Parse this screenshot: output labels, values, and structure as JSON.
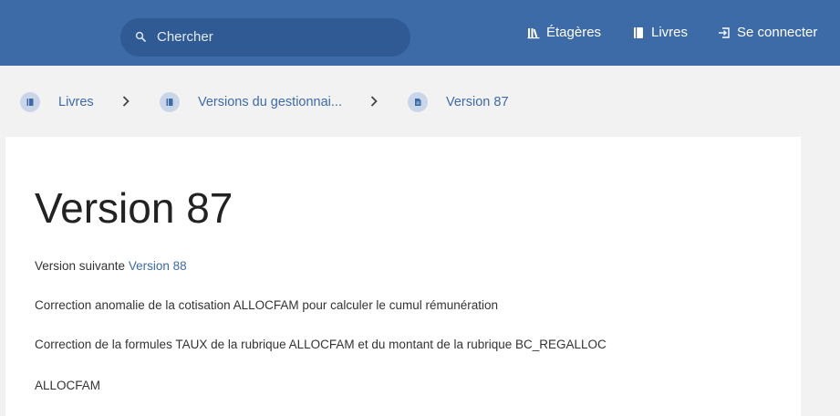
{
  "header": {
    "search": {
      "placeholder": "Chercher",
      "icon": "search-icon"
    },
    "nav": [
      {
        "label": "Étagères",
        "icon": "shelves-icon"
      },
      {
        "label": "Livres",
        "icon": "book-icon"
      },
      {
        "label": "Se connecter",
        "icon": "login-icon"
      }
    ]
  },
  "breadcrumb": [
    {
      "label": "Livres",
      "icon": "books-icon"
    },
    {
      "label": "Versions du gestionnai...",
      "icon": "book-icon"
    },
    {
      "label": "Version 87",
      "icon": "page-icon"
    }
  ],
  "page": {
    "title": "Version 87",
    "next_prefix": "Version suivante",
    "next_link": "Version 88",
    "lines": [
      "Correction anomalie de la cotisation ALLOCFAM pour calculer le cumul rémunération",
      "Correction de la formules TAUX de la rubrique ALLOCFAM et du montant de la rubrique BC_REGALLOC",
      "ALLOCFAM"
    ]
  },
  "colors": {
    "header_bg": "#3d6ba8",
    "search_bg": "#2f5a93",
    "link": "#3d6ba8",
    "page_bg": "#f2f2f2",
    "card_bg": "#ffffff"
  }
}
